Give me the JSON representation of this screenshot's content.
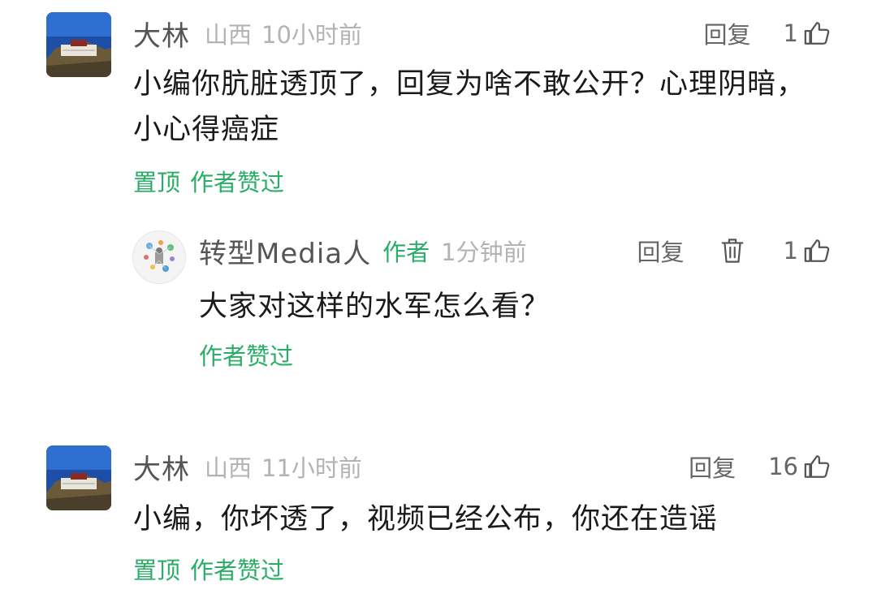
{
  "comments": [
    {
      "username": "大林",
      "location": "山西",
      "time": "10小时前",
      "reply_label": "回复",
      "likes": "1",
      "content": "小编你肮脏透顶了，回复为啥不敢公开？心理阴暗，小心得癌症",
      "tags": [
        "置顶",
        "作者赞过"
      ],
      "reply": {
        "username": "转型Media人",
        "author_tag": "作者",
        "time": "1分钟前",
        "reply_label": "回复",
        "likes": "1",
        "content": "大家对这样的水军怎么看？",
        "tags": [
          "作者赞过"
        ]
      }
    },
    {
      "username": "大林",
      "location": "山西",
      "time": "11小时前",
      "reply_label": "回复",
      "likes": "16",
      "content": "小编，你坏透了，视频已经公布，你还在造谣",
      "tags": [
        "置顶",
        "作者赞过"
      ]
    }
  ],
  "colors": {
    "accent_green": "#2aae67",
    "meta_gray": "#b3b3b3",
    "text": "#1a1a1a"
  },
  "icons": {
    "like": "thumbs-up-icon",
    "delete": "trash-icon"
  }
}
